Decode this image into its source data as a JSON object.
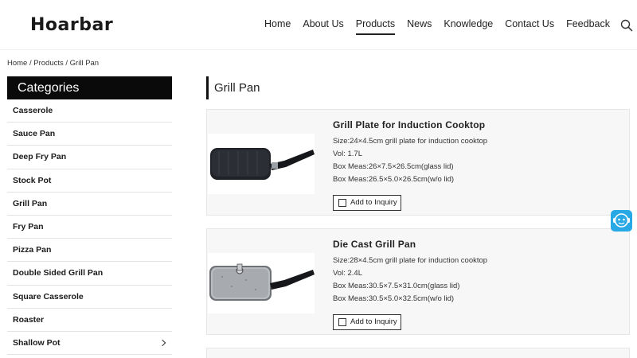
{
  "header": {
    "logo": "Hoarbar",
    "nav": [
      {
        "label": "Home"
      },
      {
        "label": "About Us"
      },
      {
        "label": "Products",
        "active": true
      },
      {
        "label": "News"
      },
      {
        "label": "Knowledge"
      },
      {
        "label": "Contact Us"
      },
      {
        "label": "Feedback"
      }
    ],
    "search_icon": "search-icon"
  },
  "breadcrumb": "Home / Products / Grill Pan",
  "sidebar": {
    "title": "Categories",
    "items": [
      {
        "label": "Casserole"
      },
      {
        "label": "Sauce Pan"
      },
      {
        "label": "Deep Fry Pan"
      },
      {
        "label": "Stock Pot"
      },
      {
        "label": "Grill Pan"
      },
      {
        "label": "Fry Pan"
      },
      {
        "label": "Pizza Pan"
      },
      {
        "label": "Double Sided Grill Pan"
      },
      {
        "label": "Square Casserole"
      },
      {
        "label": "Roaster"
      },
      {
        "label": "Shallow Pot",
        "has_submenu": true
      }
    ]
  },
  "main": {
    "title": "Grill Pan",
    "products": [
      {
        "name": "Grill Plate for Induction Cooktop",
        "specs": [
          "Size:24×4.5cm grill plate for induction cooktop",
          "Vol: 1.7L",
          "Box Meas:26×7.5×26.5cm(glass lid)",
          "Box Meas:26.5×5.0×26.5cm(w/o lid)"
        ],
        "button": "Add to Inquiry"
      },
      {
        "name": "Die Cast Grill Pan",
        "specs": [
          "Size:28×4.5cm grill plate for induction cooktop",
          "Vol: 2.4L",
          "Box Meas:30.5×7.5×31.0cm(glass lid)",
          "Box Meas:30.5×5.0×32.5cm(w/o lid)"
        ],
        "button": "Add to Inquiry"
      }
    ]
  },
  "colors": {
    "accent": "#0a0a0a",
    "chat": "#29a8e6",
    "card_bg": "#f7f7f7"
  }
}
